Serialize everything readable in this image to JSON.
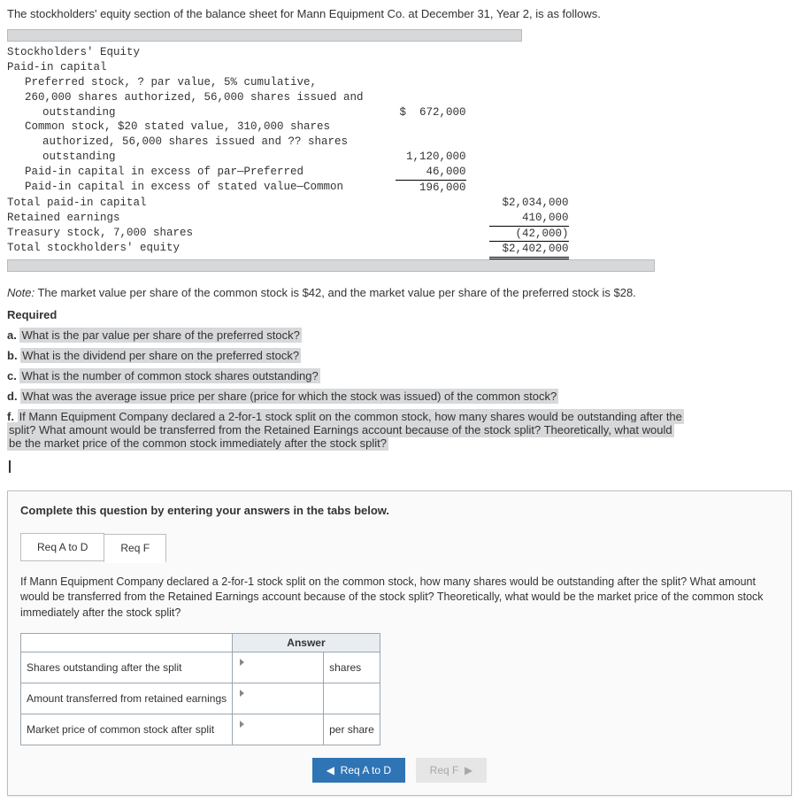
{
  "intro": "The stockholders' equity section of the balance sheet for Mann Equipment Co. at December 31, Year 2, is as follows.",
  "equity": {
    "heading": "Stockholders' Equity",
    "paidin_label": "Paid-in capital",
    "pref_line1": "Preferred stock, ? par value, 5% cumulative,",
    "pref_line2": "260,000 shares authorized, 56,000 shares issued and",
    "pref_line3": "outstanding",
    "pref_amount": "$  672,000",
    "com_line1": "Common stock, $20 stated value, 310,000 shares",
    "com_line2": "authorized, 56,000 shares issued and ?? shares",
    "com_line3": "outstanding",
    "com_amount": "1,120,000",
    "pic_excess_pref": "Paid-in capital in excess of par—Preferred",
    "pic_excess_pref_amt": "46,000",
    "pic_excess_com": "Paid-in capital in excess of stated value—Common",
    "pic_excess_com_amt": "196,000",
    "total_pic": "Total paid-in capital",
    "total_pic_amt": "$2,034,000",
    "re_label": "Retained earnings",
    "re_amt": "410,000",
    "treasury_label": "Treasury stock, 7,000 shares",
    "treasury_amt": "(42,000)",
    "total_se": "Total stockholders' equity",
    "total_se_amt": "$2,402,000"
  },
  "note_prefix": "Note:",
  "note_text": " The market value per share of the common stock is $42, and the market value per share of the preferred stock is $28.",
  "required": "Required",
  "qa": {
    "a_pre": "a. ",
    "a": "What is the par value per share of the preferred stock?",
    "b_pre": "b. ",
    "b": "What is the dividend per share on the preferred stock?",
    "c_pre": "c. ",
    "c": "What is the number of common stock shares outstanding?",
    "d_pre": "d. ",
    "d": "What was the average issue price per share (price for which the stock was issued) of the common stock?",
    "f_pre": "f. ",
    "f1": "If Mann Equipment Company declared a 2-for-1 stock split on the common stock, how many shares would be outstanding after the",
    "f2": "split? What amount would be transferred from the Retained Earnings account because of the stock split? Theoretically, what would",
    "f3": "be the market price of the common stock immediately after the stock split?"
  },
  "ans": {
    "instr": "Complete this question by entering your answers in the tabs below.",
    "tab1": "Req A to D",
    "tab2": "Req F",
    "panel_text": "If Mann Equipment Company declared a 2-for-1 stock split on the common stock, how many shares would be outstanding after the split? What amount would be transferred from the Retained Earnings account because of the stock split? Theoretically, what would be the market price of the common stock immediately after the stock split?",
    "th_answer": "Answer",
    "row1": "Shares outstanding after the split",
    "row1_unit": "shares",
    "row2": "Amount transferred from retained earnings",
    "row3": "Market price of common stock after split",
    "row3_unit": "per share",
    "prev": "Req A to D",
    "next": "Req F"
  }
}
